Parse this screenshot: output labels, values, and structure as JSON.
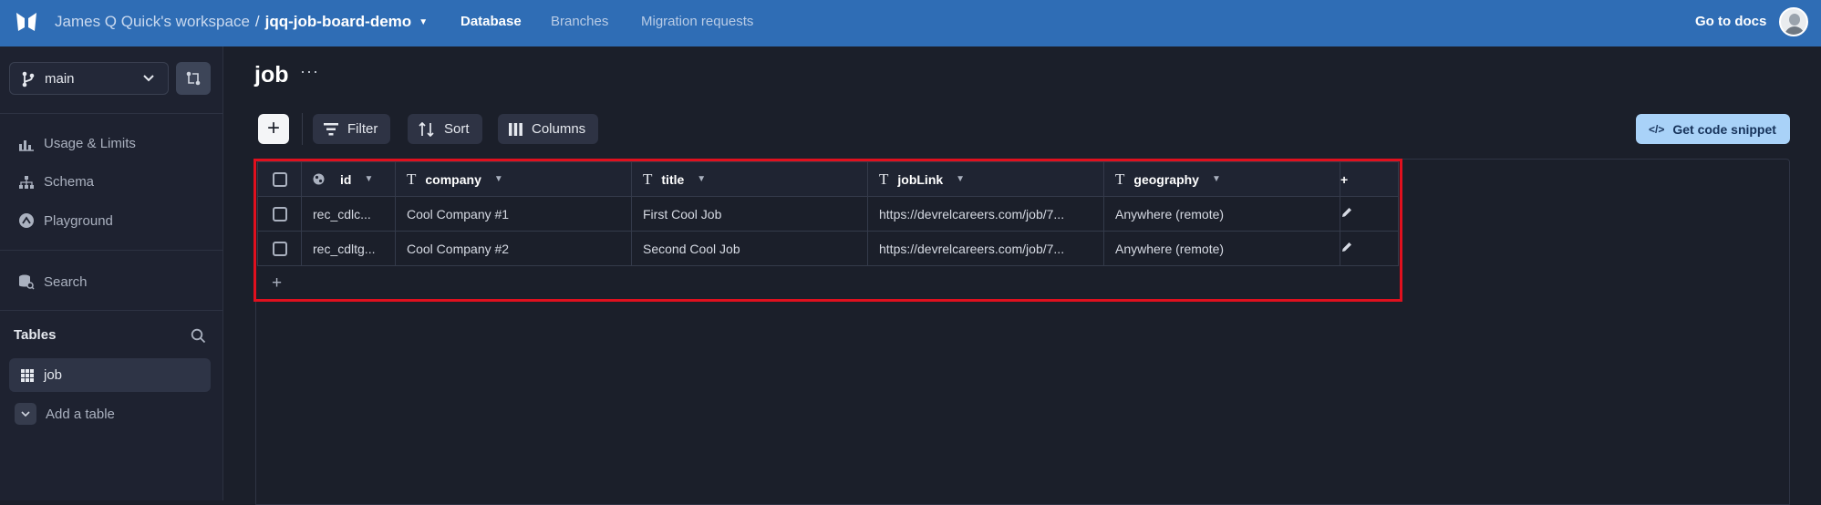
{
  "topbar": {
    "workspace": "James Q Quick's workspace",
    "separator": "/",
    "database": "jqq-job-board-demo",
    "nav": [
      "Database",
      "Branches",
      "Migration requests"
    ],
    "docs": "Go to docs",
    "icons": {
      "logo": "xata-butterfly-logo",
      "caret": "caret-down-icon",
      "avatar": "user-avatar"
    }
  },
  "sidebar": {
    "branch": "main",
    "items": [
      "Usage & Limits",
      "Schema",
      "Playground",
      "Search"
    ],
    "tables_heading": "Tables",
    "tables": [
      "job"
    ],
    "add_table": "Add a table"
  },
  "main": {
    "title": "job",
    "more": "···",
    "toolbar": {
      "add": "+",
      "filter": "Filter",
      "sort": "Sort",
      "columns": "Columns",
      "snippet": "Get code snippet",
      "snippet_icon": "</>"
    },
    "table": {
      "columns": [
        "id",
        "company",
        "title",
        "jobLink",
        "geography"
      ],
      "type_icon": "T",
      "add_column": "+",
      "add_row": "+",
      "rows": [
        {
          "id": "rec_cdlc...",
          "company": "Cool Company #1",
          "title": "First Cool Job",
          "jobLink": "https://devrelcareers.com/job/7...",
          "geography": "Anywhere (remote)"
        },
        {
          "id": "rec_cdltg...",
          "company": "Cool Company #2",
          "title": "Second Cool Job",
          "jobLink": "https://devrelcareers.com/job/7...",
          "geography": "Anywhere (remote)"
        }
      ]
    }
  },
  "colors": {
    "topbar": "#2f6db5",
    "background": "#1b1f2a",
    "snippet": "#a9d2f8",
    "highlight": "#e0101e"
  }
}
